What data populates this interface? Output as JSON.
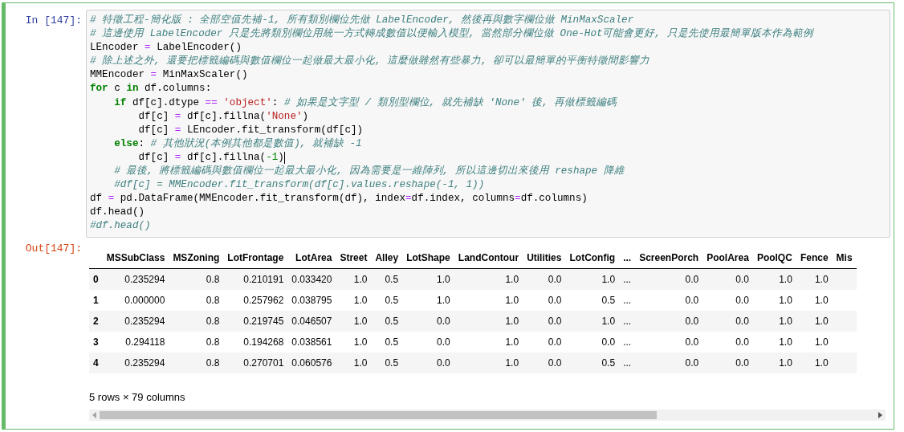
{
  "input_prompt": "In [147]:",
  "code_lines": [
    {
      "tokens": [
        {
          "kind": "comment",
          "text": "# 特徵工程-簡化版 : 全部空值先補-1, 所有類別欄位先做 LabelEncoder, 然後再與數字欄位做 MinMaxScaler"
        }
      ]
    },
    {
      "tokens": [
        {
          "kind": "comment",
          "text": "# 這邊使用 LabelEncoder 只是先將類別欄位用統一方式轉成數值以便輸入模型, 當然部分欄位做 One-Hot可能會更好, 只是先使用最簡單版本作為範例"
        }
      ]
    },
    {
      "tokens": [
        {
          "kind": "plain",
          "text": "LEncoder "
        },
        {
          "kind": "operator",
          "text": "="
        },
        {
          "kind": "plain",
          "text": " LabelEncoder()"
        }
      ]
    },
    {
      "tokens": [
        {
          "kind": "comment",
          "text": "# 除上述之外, 還要把標籤編碼與數值欄位一起做最大最小化, 這麼做雖然有些暴力, 卻可以最簡單的平衡特徵間影響力"
        }
      ]
    },
    {
      "tokens": [
        {
          "kind": "plain",
          "text": "MMEncoder "
        },
        {
          "kind": "operator",
          "text": "="
        },
        {
          "kind": "plain",
          "text": " MinMaxScaler()"
        }
      ]
    },
    {
      "tokens": [
        {
          "kind": "keyword",
          "text": "for"
        },
        {
          "kind": "plain",
          "text": " c "
        },
        {
          "kind": "keyword",
          "text": "in"
        },
        {
          "kind": "plain",
          "text": " df.columns:"
        }
      ]
    },
    {
      "tokens": [
        {
          "kind": "keyword",
          "text": "    if"
        },
        {
          "kind": "plain",
          "text": " df[c].dtype "
        },
        {
          "kind": "operator",
          "text": "== "
        },
        {
          "kind": "string",
          "text": "'object'"
        },
        {
          "kind": "plain",
          "text": ": "
        },
        {
          "kind": "comment",
          "text": "# 如果是文字型 / 類別型欄位, 就先補缺 'None' 後, 再做標籤編碼"
        }
      ]
    },
    {
      "tokens": [
        {
          "kind": "plain",
          "text": "        df[c] "
        },
        {
          "kind": "operator",
          "text": "="
        },
        {
          "kind": "plain",
          "text": " df[c].fillna("
        },
        {
          "kind": "string",
          "text": "'None'"
        },
        {
          "kind": "plain",
          "text": ")"
        }
      ]
    },
    {
      "tokens": [
        {
          "kind": "plain",
          "text": "        df[c] "
        },
        {
          "kind": "operator",
          "text": "="
        },
        {
          "kind": "plain",
          "text": " LEncoder.fit_transform(df[c])"
        }
      ]
    },
    {
      "tokens": [
        {
          "kind": "keyword",
          "text": "    else"
        },
        {
          "kind": "plain",
          "text": ": "
        },
        {
          "kind": "comment",
          "text": "# 其他狀況(本例其他都是數值), 就補缺 -1"
        }
      ]
    },
    {
      "cursor": true,
      "tokens": [
        {
          "kind": "plain",
          "text": "        df[c] "
        },
        {
          "kind": "operator",
          "text": "="
        },
        {
          "kind": "plain",
          "text": " df[c].fillna("
        },
        {
          "kind": "number",
          "text": "-1"
        },
        {
          "kind": "plain",
          "text": ")"
        }
      ]
    },
    {
      "tokens": [
        {
          "kind": "comment",
          "text": "    # 最後, 將標籤編碼與數值欄位一起最大最小化, 因為需要是一維陣列, 所以這邊切出來後用 reshape 降維"
        }
      ]
    },
    {
      "tokens": [
        {
          "kind": "comment",
          "text": "    #df[c] = MMEncoder.fit_transform(df[c].values.reshape(-1, 1))"
        }
      ]
    },
    {
      "tokens": [
        {
          "kind": "plain",
          "text": "df "
        },
        {
          "kind": "operator",
          "text": "="
        },
        {
          "kind": "plain",
          "text": " pd.DataFrame(MMEncoder.fit_transform(df), index"
        },
        {
          "kind": "operator",
          "text": "="
        },
        {
          "kind": "plain",
          "text": "df.index, columns"
        },
        {
          "kind": "operator",
          "text": "="
        },
        {
          "kind": "plain",
          "text": "df.columns)"
        }
      ]
    },
    {
      "tokens": [
        {
          "kind": "plain",
          "text": "df.head()"
        }
      ]
    },
    {
      "tokens": [
        {
          "kind": "comment",
          "text": "#df.head()"
        }
      ]
    }
  ],
  "output_prompt": "Out[147]:",
  "table": {
    "columns": [
      "MSSubClass",
      "MSZoning",
      "LotFrontage",
      "LotArea",
      "Street",
      "Alley",
      "LotShape",
      "LandContour",
      "Utilities",
      "LotConfig",
      "...",
      "ScreenPorch",
      "PoolArea",
      "PoolQC",
      "Fence",
      "Mis"
    ],
    "rows": [
      {
        "index": "0",
        "cells": [
          "0.235294",
          "0.8",
          "0.210191",
          "0.033420",
          "1.0",
          "0.5",
          "1.0",
          "1.0",
          "0.0",
          "1.0",
          "...",
          "0.0",
          "0.0",
          "1.0",
          "1.0"
        ]
      },
      {
        "index": "1",
        "cells": [
          "0.000000",
          "0.8",
          "0.257962",
          "0.038795",
          "1.0",
          "0.5",
          "1.0",
          "1.0",
          "0.0",
          "0.5",
          "...",
          "0.0",
          "0.0",
          "1.0",
          "1.0"
        ]
      },
      {
        "index": "2",
        "cells": [
          "0.235294",
          "0.8",
          "0.219745",
          "0.046507",
          "1.0",
          "0.5",
          "0.0",
          "1.0",
          "0.0",
          "1.0",
          "...",
          "0.0",
          "0.0",
          "1.0",
          "1.0"
        ]
      },
      {
        "index": "3",
        "cells": [
          "0.294118",
          "0.8",
          "0.194268",
          "0.038561",
          "1.0",
          "0.5",
          "0.0",
          "1.0",
          "0.0",
          "0.0",
          "...",
          "0.0",
          "0.0",
          "1.0",
          "1.0"
        ]
      },
      {
        "index": "4",
        "cells": [
          "0.235294",
          "0.8",
          "0.270701",
          "0.060576",
          "1.0",
          "0.5",
          "0.0",
          "1.0",
          "0.0",
          "0.5",
          "...",
          "0.0",
          "0.0",
          "1.0",
          "1.0"
        ]
      }
    ]
  },
  "shape_note": "5 rows × 79 columns"
}
